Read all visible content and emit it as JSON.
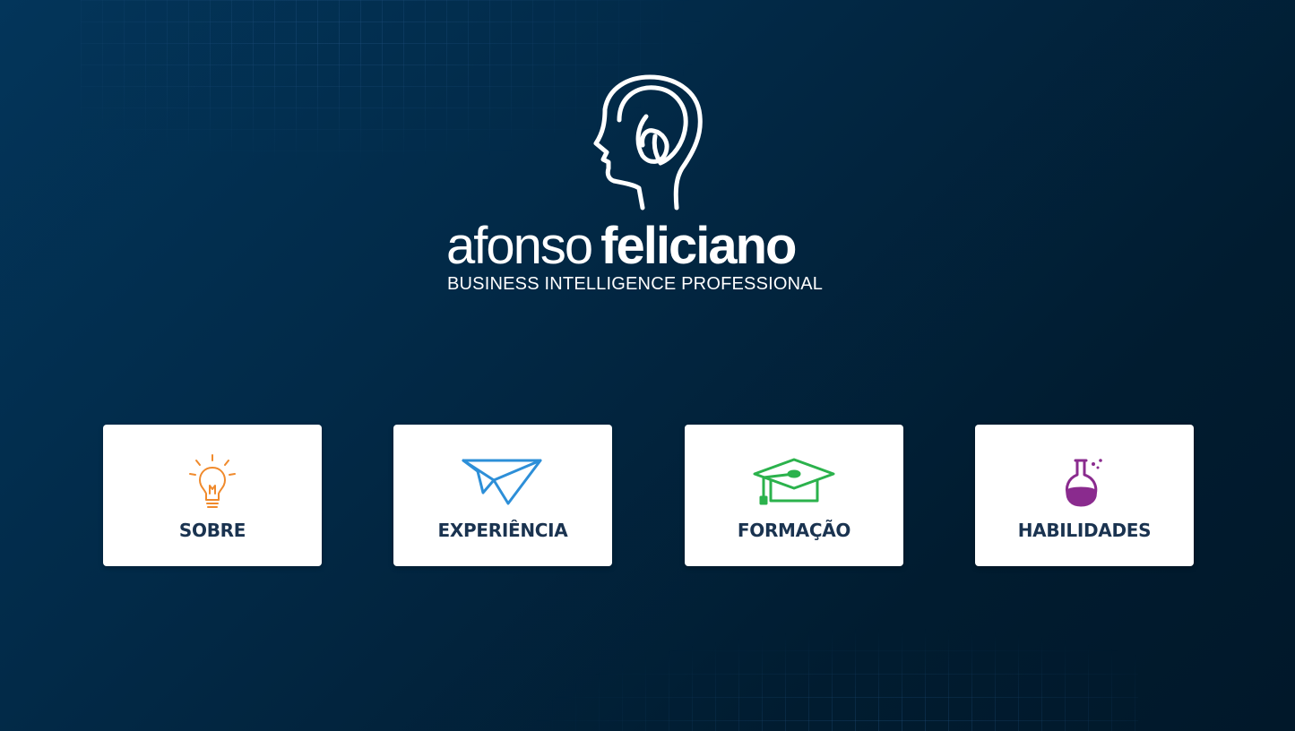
{
  "brand": {
    "first_name": "afonso",
    "last_name": "feliciano",
    "tagline": "BUSINESS INTELLIGENCE PROFESSIONAL",
    "logo_icon": "head-profile-icon"
  },
  "nav_cards": [
    {
      "label": "SOBRE",
      "icon": "lightbulb-icon",
      "color": "#f08a2c"
    },
    {
      "label": "EXPERIÊNCIA",
      "icon": "paper-plane-icon",
      "color": "#2d8fd8"
    },
    {
      "label": "FORMAÇÃO",
      "icon": "graduation-cap-icon",
      "color": "#2bb24c"
    },
    {
      "label": "HABILIDADES",
      "icon": "flask-icon",
      "color": "#8a2b8e"
    }
  ],
  "colors": {
    "background": "#022a48",
    "card_background": "#ffffff",
    "label_text": "#1a3350"
  }
}
